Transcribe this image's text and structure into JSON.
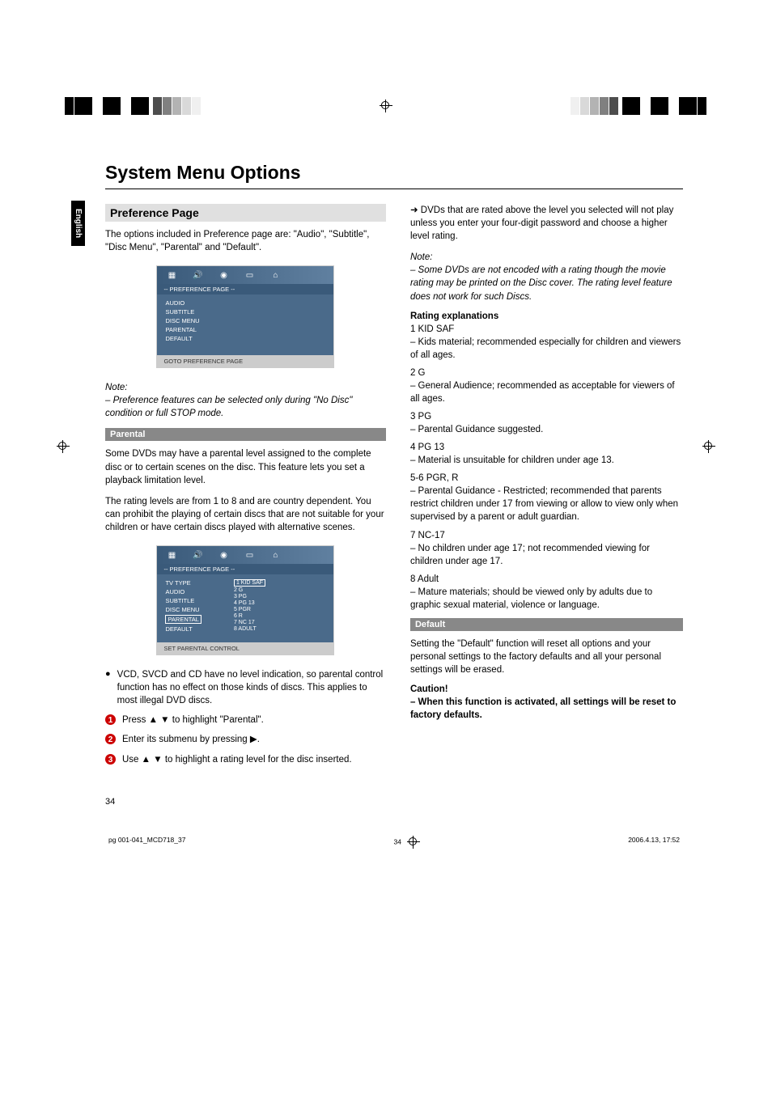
{
  "sideTab": "English",
  "pageTitle": "System Menu Options",
  "sectionTitle": "Preference Page",
  "introText": "The options included in Preference page are: \"Audio\", \"Subtitle\", \"Disc Menu\", \"Parental\" and \"Default\".",
  "screenshot1": {
    "subtitle": "-- PREFERENCE PAGE --",
    "items": [
      "AUDIO",
      "SUBTITLE",
      "DISC MENU",
      "PARENTAL",
      "DEFAULT"
    ],
    "footer": "GOTO PREFERENCE PAGE"
  },
  "note1": {
    "label": "Note:",
    "text": "–   Preference features can be selected only during \"No Disc\" condition or full STOP mode."
  },
  "parental": {
    "bar": "Parental",
    "para1": "Some DVDs may have a parental level assigned to the complete disc or to certain scenes on the disc. This feature lets you set a playback limitation level.",
    "para2": "The rating levels are from 1 to 8 and are country dependent. You can prohibit the playing of certain discs that are not suitable for your children or have certain discs played with alternative scenes."
  },
  "screenshot2": {
    "subtitle": "-- PREFERENCE PAGE --",
    "itemsLeft": [
      "TV TYPE",
      "AUDIO",
      "SUBTITLE",
      "DISC MENU",
      "PARENTAL",
      "DEFAULT"
    ],
    "itemsRight": [
      "1 KID SAF",
      "2 G",
      "3 PG",
      "4 PG 13",
      "5 PGR",
      "6 R",
      "7 NC 17",
      "8 ADULT"
    ],
    "footer": "SET PARENTAL CONTROL"
  },
  "bullets": {
    "b0": "VCD, SVCD and CD have no level indication, so parental control function has no effect on those kinds of discs. This applies to most illegal DVD discs.",
    "b1_pre": "Press ",
    "b1_post": " to highlight \"Parental\".",
    "b2_pre": "Enter its submenu by pressing ",
    "b2_post": ".",
    "b3_pre": "Use ",
    "b3_post": " to highlight a rating level for the disc inserted."
  },
  "rightArrowText": "DVDs that are rated above the level you selected will not play unless you enter your four-digit password and choose a higher level rating.",
  "note2": {
    "label": "Note:",
    "text": "–   Some DVDs are not encoded with a rating though the movie rating may be printed on the Disc cover. The rating level feature does not work for such Discs."
  },
  "ratings": {
    "heading": "Rating explanations",
    "r1": {
      "label": "1 KID SAF",
      "desc": "–  Kids material; recommended especially for children and viewers of all ages."
    },
    "r2": {
      "label": "2 G",
      "desc": "–  General Audience; recommended as acceptable for viewers of all ages."
    },
    "r3": {
      "label": "3 PG",
      "desc": "–  Parental Guidance suggested."
    },
    "r4": {
      "label": "4 PG 13",
      "desc": "–  Material is unsuitable for children under age 13."
    },
    "r5": {
      "label": "5-6 PGR, R",
      "desc": "–  Parental Guidance - Restricted; recommended that parents restrict children under 17 from viewing or allow to view only when supervised by a parent or adult guardian."
    },
    "r6": {
      "label": "7 NC-17",
      "desc": "–  No children under age 17; not recommended viewing for children under age 17."
    },
    "r7": {
      "label": "8 Adult",
      "desc": "–  Mature materials; should be viewed only by adults due to graphic sexual material, violence or language."
    }
  },
  "default": {
    "bar": "Default",
    "text": "Setting the \"Default\" function will reset all options and your personal settings to the factory defaults and all your personal settings will be erased."
  },
  "caution": {
    "heading": "Caution!",
    "text": "–   When this function is activated, all settings will be reset to factory defaults."
  },
  "pageNumber": "34",
  "footer": {
    "left": "pg 001-041_MCD718_37",
    "center": "34",
    "right": "2006.4.13, 17:52"
  }
}
